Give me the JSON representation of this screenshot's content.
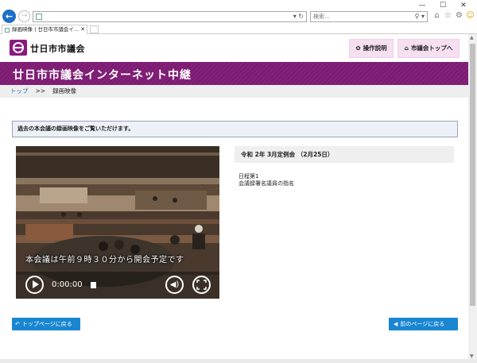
{
  "browser": {
    "window_controls": [
      "—",
      "☐",
      "✕"
    ],
    "tab_title": "録画映像 | 廿日市市議会イ...",
    "search_placeholder": "検索..."
  },
  "header": {
    "logo_text": "廿日市市議会",
    "help_label": "操作説明",
    "top_label": "市議会トップへ"
  },
  "title_band": {
    "title": "廿日市市議会インターネット中継"
  },
  "breadcrumb": {
    "home": "トップ",
    "separator": ">>",
    "current": "録画映像"
  },
  "notice": {
    "text": "過去の本会議の録画映像をご覧いただけます。"
  },
  "player": {
    "caption": "本会議は午前９時３０分から開会予定です",
    "time": "0:00:00"
  },
  "session": {
    "title": "令和 2年 3月定例会 （2月25日）",
    "agenda_label": "日程第1",
    "agenda_item": "会議録署名議員の指名"
  },
  "buttons": {
    "back_top": "トップページに戻る",
    "back_prev": "前のページに戻る"
  },
  "colors": {
    "brand_purple": "#7d1a73",
    "header_button_bg": "#f6dff0",
    "action_blue": "#1a86d2"
  }
}
